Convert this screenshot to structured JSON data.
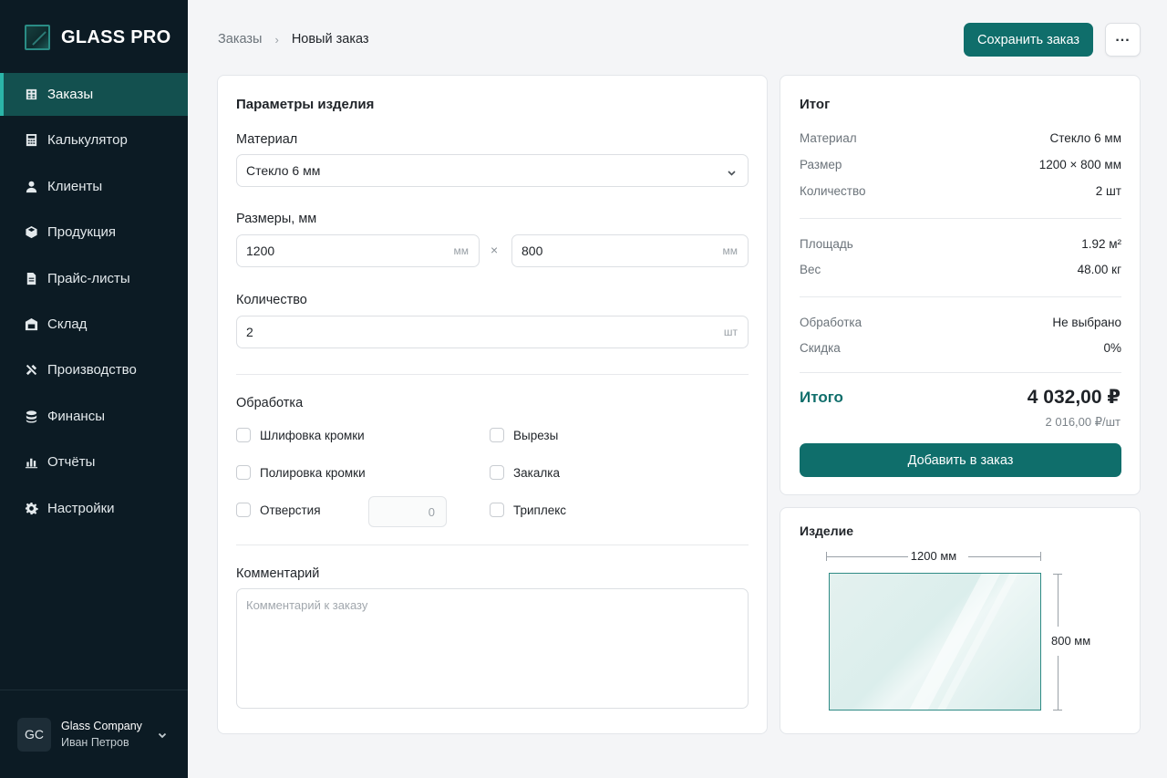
{
  "brand": {
    "name": "GLASS PRO"
  },
  "nav": [
    {
      "label": "Заказы",
      "icon": "orders-icon",
      "active": true
    },
    {
      "label": "Калькулятор",
      "icon": "calculator-icon",
      "active": false
    },
    {
      "label": "Клиенты",
      "icon": "user-icon",
      "active": false
    },
    {
      "label": "Продукция",
      "icon": "box-icon",
      "active": false
    },
    {
      "label": "Прайс-листы",
      "icon": "document-icon",
      "active": false
    },
    {
      "label": "Склад",
      "icon": "warehouse-icon",
      "active": false
    },
    {
      "label": "Производство",
      "icon": "tools-icon",
      "active": false
    },
    {
      "label": "Финансы",
      "icon": "coins-icon",
      "active": false
    },
    {
      "label": "Отчёты",
      "icon": "bar-chart-icon",
      "active": false
    },
    {
      "label": "Настройки",
      "icon": "gear-icon",
      "active": false
    }
  ],
  "user": {
    "initials": "GC",
    "company": "Glass Company",
    "name": "Иван Петров"
  },
  "breadcrumb": {
    "parent": "Заказы",
    "separator": "›",
    "current": "Новый заказ"
  },
  "header": {
    "save_label": "Сохранить заказ",
    "more_label": "..."
  },
  "params": {
    "title": "Параметры изделия",
    "material_label": "Материал",
    "material_value": "Стекло 6 мм",
    "size_label": "Размеры, мм",
    "width_value": "1200",
    "height_value": "800",
    "size_unit": "мм",
    "times": "×",
    "quantity_label": "Количество",
    "quantity_value": "2",
    "quantity_unit": "шт",
    "processing_title": "Обработка",
    "options": {
      "edge_grinding": "Шлифовка кромки",
      "edge_polishing": "Полировка кромки",
      "holes": "Отверстия",
      "cutouts": "Вырезы",
      "tempering": "Закалка",
      "triplex": "Триплекс"
    },
    "holes_value": "0",
    "comment_label": "Комментарий",
    "comment_placeholder": "Комментарий к заказу"
  },
  "summary": {
    "title": "Итог",
    "rows": [
      {
        "key": "Материал",
        "value": "Стекло 6 мм"
      },
      {
        "key": "Размер",
        "value": "1200 × 800 мм"
      },
      {
        "key": "Количество",
        "value": "2 шт"
      },
      {
        "key": "Площадь",
        "value": "1.92 м²"
      },
      {
        "key": "Вес",
        "value": "48.00 кг"
      },
      {
        "key": "Обработка",
        "value": "Не выбрано"
      },
      {
        "key": "Скидка",
        "value": "0%"
      }
    ],
    "total_label": "Итого",
    "total_value": "4 032,00 ₽",
    "per_unit": "2 016,00 ₽/шт",
    "add_label": "Добавить в заказ"
  },
  "preview": {
    "title": "Изделие",
    "width_label": "1200 мм",
    "height_label": "800 мм"
  },
  "colors": {
    "accent": "#0f6e6b",
    "sidebar": "#0c1b24",
    "active_nav": "#13504f"
  }
}
